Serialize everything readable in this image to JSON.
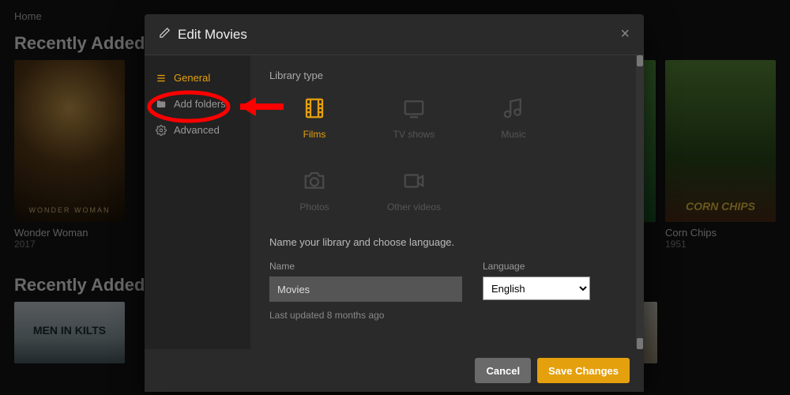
{
  "nav": {
    "home": "Home"
  },
  "sections": {
    "recent_movies": "Recently Added in M",
    "recent_tv": "Recently Added in T"
  },
  "cards": {
    "wonder_woman": {
      "title": "Wonder Woman",
      "year": "2017"
    },
    "corn_chips": {
      "title": "Corn Chips",
      "year": "1951"
    }
  },
  "modal": {
    "title": "Edit Movies",
    "sidebar": {
      "general": "General",
      "add_folders": "Add folders",
      "advanced": "Advanced"
    },
    "pane": {
      "library_type_label": "Library type",
      "types": {
        "films": "Films",
        "tv": "TV shows",
        "music": "Music",
        "photos": "Photos",
        "other": "Other videos"
      },
      "helper": "Name your library and choose language.",
      "name_label": "Name",
      "name_value": "Movies",
      "lang_label": "Language",
      "lang_value": "English",
      "last_updated": "Last updated 8 months ago"
    },
    "footer": {
      "cancel": "Cancel",
      "save": "Save Changes"
    }
  },
  "colors": {
    "accent": "#e5a00d",
    "annotation": "#ff0000"
  }
}
